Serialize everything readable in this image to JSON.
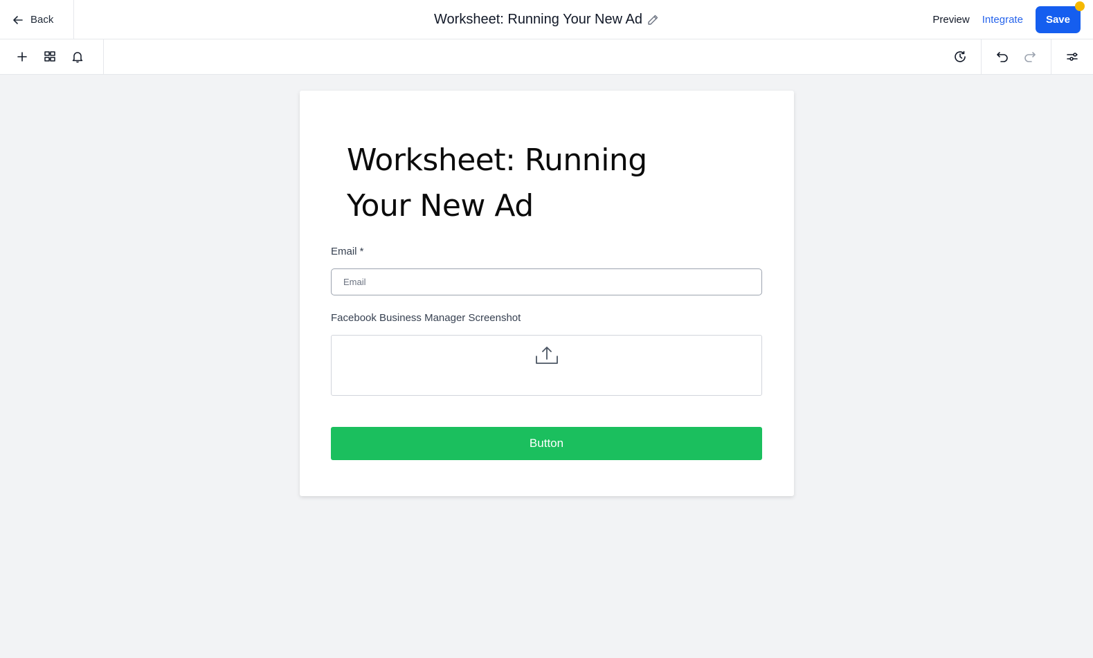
{
  "header": {
    "back_label": "Back",
    "title": "Worksheet: Running Your New Ad",
    "preview_label": "Preview",
    "integrate_label": "Integrate",
    "save_label": "Save",
    "save_color": "#155eef",
    "integrate_color": "#2563eb",
    "unsaved_dot_color": "#f5b800"
  },
  "toolbar": {
    "left_icons": [
      "plus-icon",
      "elements-icon",
      "bell-icon"
    ],
    "right_icons": [
      "history-icon",
      "undo-icon",
      "redo-icon",
      "settings-sliders-icon"
    ]
  },
  "form": {
    "heading": "Worksheet: Running Your New Ad",
    "email": {
      "label": "Email *",
      "placeholder": "Email",
      "value": ""
    },
    "upload": {
      "label": "Facebook Business Manager Screenshot",
      "icon": "upload-icon"
    },
    "submit": {
      "label": "Button",
      "color": "#1bbf5e"
    }
  }
}
